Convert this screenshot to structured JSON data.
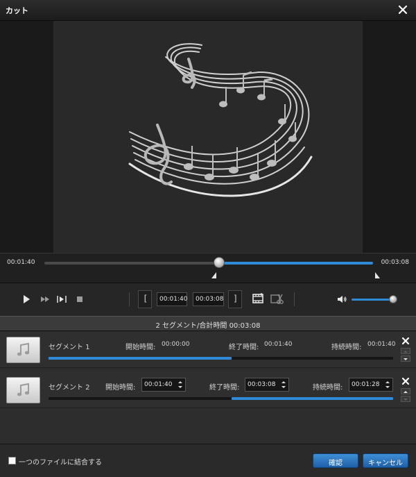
{
  "window": {
    "title": "カット"
  },
  "timeline": {
    "start_time": "00:01:40",
    "end_time": "00:03:08",
    "position_fraction": 0.53
  },
  "controls": {
    "start_field": "00:01:40",
    "end_field": "00:03:08",
    "volume_fraction": 1.0
  },
  "summary": {
    "text": "2 セグメント/合計時間 00:03:08"
  },
  "segments": [
    {
      "name": "セグメント 1",
      "start_label": "開始時間:",
      "start_value": "00:00:00",
      "end_label": "終了時間:",
      "end_value": "00:01:40",
      "duration_label": "持続時間:",
      "duration_value": "00:01:40",
      "range_fraction": [
        0.0,
        0.53
      ]
    },
    {
      "name": "セグメント 2",
      "start_label": "開始時間:",
      "start_value": "00:01:40",
      "end_label": "終了時間:",
      "end_value": "00:03:08",
      "duration_label": "持続時間:",
      "duration_value": "00:01:28",
      "range_fraction": [
        0.53,
        1.0
      ]
    }
  ],
  "footer": {
    "merge_label": "一つのファイルに結合する",
    "merge_checked": false,
    "ok_label": "確認",
    "cancel_label": "キャンセル"
  },
  "colors": {
    "accent": "#2f8ad8",
    "button": "#2a74c4"
  }
}
